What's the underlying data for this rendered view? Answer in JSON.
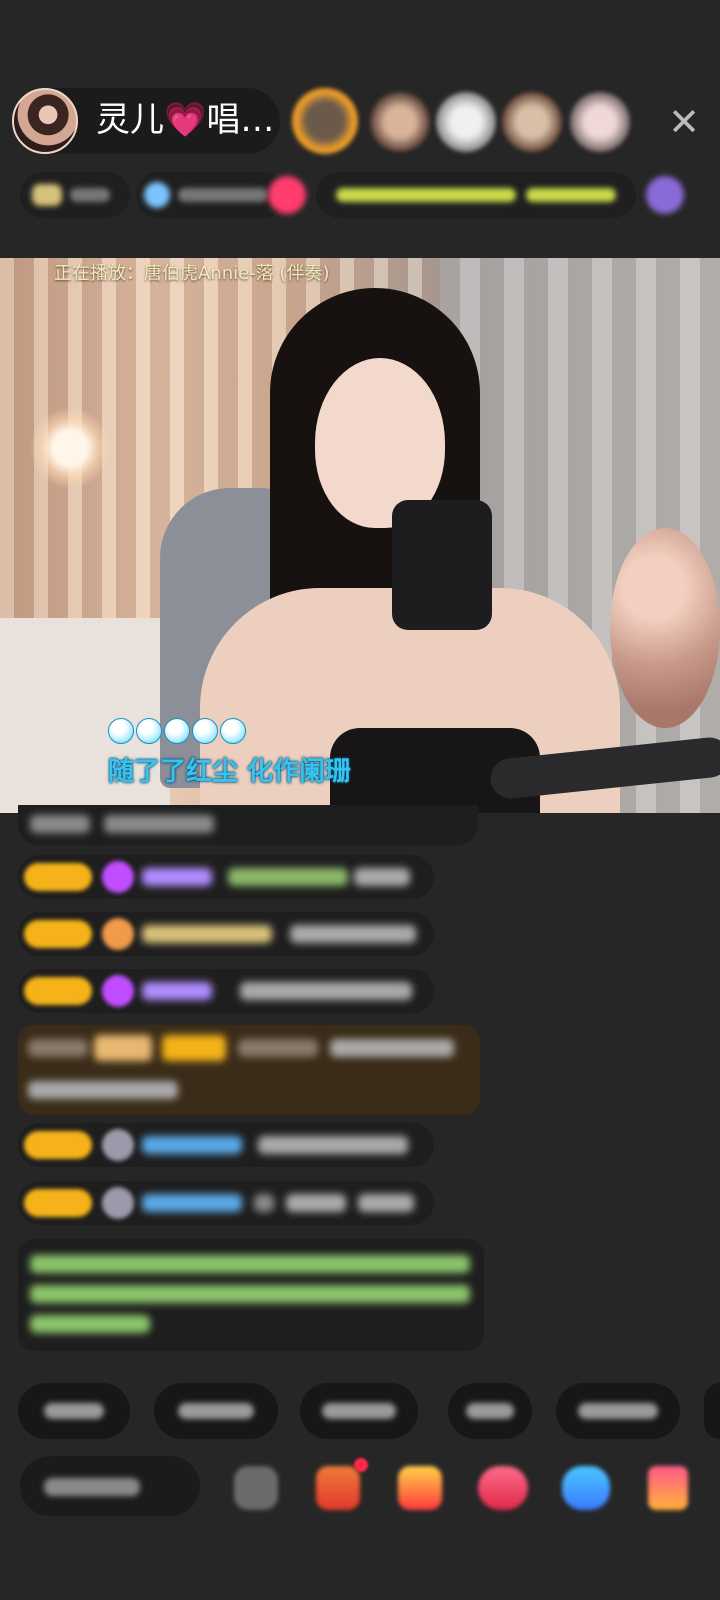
{
  "header": {
    "host_name": "灵儿💗唱…",
    "close_icon": "close-icon"
  },
  "video": {
    "now_playing": "正在播放：唐伯虎Annie-落 (伴奏)",
    "lyric_dot_count": 5,
    "lyric": "随了了红尘  化作阑珊"
  },
  "colors": {
    "background": "#262626",
    "lyric": "#37c3f0",
    "badge": "#f5b319",
    "system_message": "#8cc46a"
  }
}
